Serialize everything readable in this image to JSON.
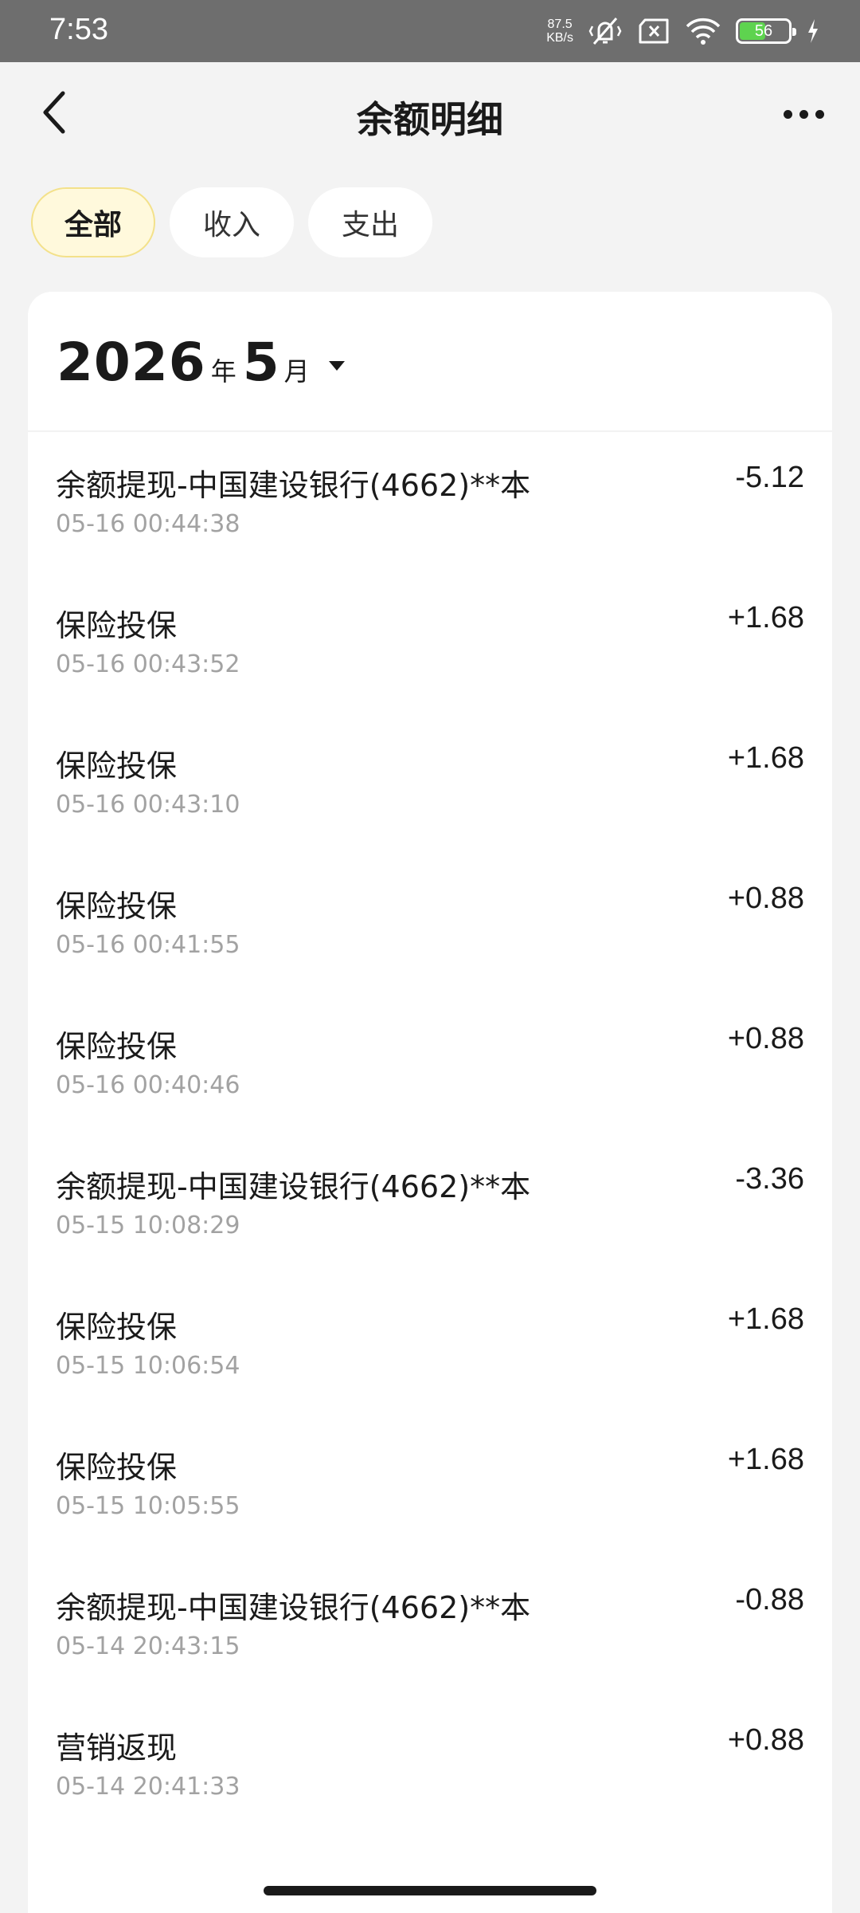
{
  "status_bar": {
    "time": "7:53",
    "net_speed_value": "87.5",
    "net_speed_unit": "KB/s",
    "battery_level": "56",
    "battery_fill_percent": 56,
    "icons": [
      "vibrate-off-icon",
      "sim-error-icon",
      "wifi-icon",
      "battery-icon",
      "charging-icon"
    ]
  },
  "header": {
    "title": "余额明细",
    "back_icon": "chevron-left-icon",
    "more_icon": "more-dots-icon"
  },
  "tabs": [
    {
      "label": "全部",
      "active": true
    },
    {
      "label": "收入",
      "active": false
    },
    {
      "label": "支出",
      "active": false
    }
  ],
  "period": {
    "year": "2026",
    "year_unit": "年",
    "month": "5",
    "month_unit": "月"
  },
  "transactions": [
    {
      "title": "余额提现-中国建设银行(4662)**本",
      "time": "05-16 00:44:38",
      "amount": "-5.12"
    },
    {
      "title": "保险投保",
      "time": "05-16 00:43:52",
      "amount": "+1.68"
    },
    {
      "title": "保险投保",
      "time": "05-16 00:43:10",
      "amount": "+1.68"
    },
    {
      "title": "保险投保",
      "time": "05-16 00:41:55",
      "amount": "+0.88"
    },
    {
      "title": "保险投保",
      "time": "05-16 00:40:46",
      "amount": "+0.88"
    },
    {
      "title": "余额提现-中国建设银行(4662)**本",
      "time": "05-15 10:08:29",
      "amount": "-3.36"
    },
    {
      "title": "保险投保",
      "time": "05-15 10:06:54",
      "amount": "+1.68"
    },
    {
      "title": "保险投保",
      "time": "05-15 10:05:55",
      "amount": "+1.68"
    },
    {
      "title": "余额提现-中国建设银行(4662)**本",
      "time": "05-14 20:43:15",
      "amount": "-0.88"
    },
    {
      "title": "营销返现",
      "time": "05-14 20:41:33",
      "amount": "+0.88"
    }
  ],
  "colors": {
    "background": "#f3f3f3",
    "active_tab_bg": "#fff9dc",
    "active_tab_border": "#f3e18a",
    "battery_green": "#5ed34f",
    "secondary_text": "#a2a2a2"
  }
}
